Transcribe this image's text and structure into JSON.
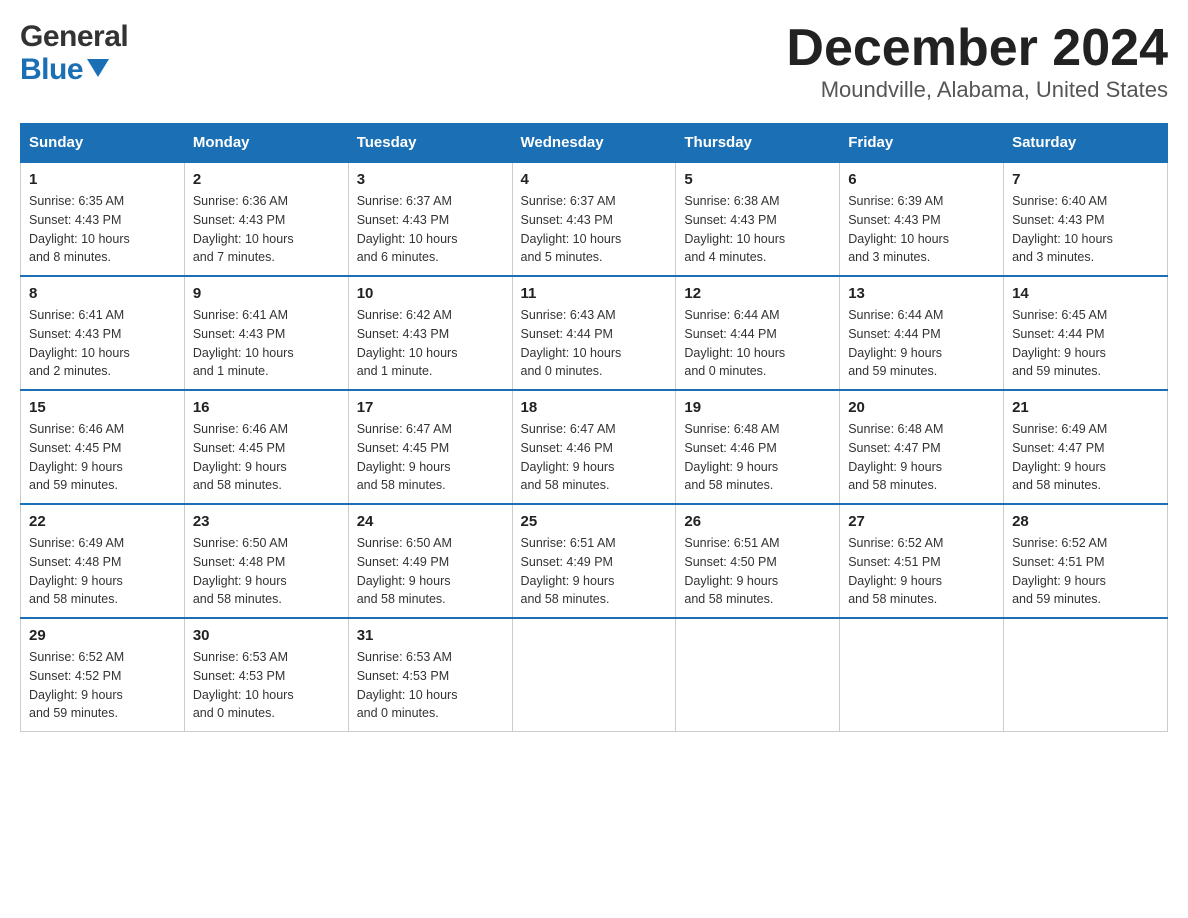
{
  "header": {
    "logo_general": "General",
    "logo_blue": "Blue",
    "month_title": "December 2024",
    "location": "Moundville, Alabama, United States"
  },
  "days_of_week": [
    "Sunday",
    "Monday",
    "Tuesday",
    "Wednesday",
    "Thursday",
    "Friday",
    "Saturday"
  ],
  "weeks": [
    [
      {
        "day": "1",
        "sunrise": "6:35 AM",
        "sunset": "4:43 PM",
        "daylight": "10 hours and 8 minutes."
      },
      {
        "day": "2",
        "sunrise": "6:36 AM",
        "sunset": "4:43 PM",
        "daylight": "10 hours and 7 minutes."
      },
      {
        "day": "3",
        "sunrise": "6:37 AM",
        "sunset": "4:43 PM",
        "daylight": "10 hours and 6 minutes."
      },
      {
        "day": "4",
        "sunrise": "6:37 AM",
        "sunset": "4:43 PM",
        "daylight": "10 hours and 5 minutes."
      },
      {
        "day": "5",
        "sunrise": "6:38 AM",
        "sunset": "4:43 PM",
        "daylight": "10 hours and 4 minutes."
      },
      {
        "day": "6",
        "sunrise": "6:39 AM",
        "sunset": "4:43 PM",
        "daylight": "10 hours and 3 minutes."
      },
      {
        "day": "7",
        "sunrise": "6:40 AM",
        "sunset": "4:43 PM",
        "daylight": "10 hours and 3 minutes."
      }
    ],
    [
      {
        "day": "8",
        "sunrise": "6:41 AM",
        "sunset": "4:43 PM",
        "daylight": "10 hours and 2 minutes."
      },
      {
        "day": "9",
        "sunrise": "6:41 AM",
        "sunset": "4:43 PM",
        "daylight": "10 hours and 1 minute."
      },
      {
        "day": "10",
        "sunrise": "6:42 AM",
        "sunset": "4:43 PM",
        "daylight": "10 hours and 1 minute."
      },
      {
        "day": "11",
        "sunrise": "6:43 AM",
        "sunset": "4:44 PM",
        "daylight": "10 hours and 0 minutes."
      },
      {
        "day": "12",
        "sunrise": "6:44 AM",
        "sunset": "4:44 PM",
        "daylight": "10 hours and 0 minutes."
      },
      {
        "day": "13",
        "sunrise": "6:44 AM",
        "sunset": "4:44 PM",
        "daylight": "9 hours and 59 minutes."
      },
      {
        "day": "14",
        "sunrise": "6:45 AM",
        "sunset": "4:44 PM",
        "daylight": "9 hours and 59 minutes."
      }
    ],
    [
      {
        "day": "15",
        "sunrise": "6:46 AM",
        "sunset": "4:45 PM",
        "daylight": "9 hours and 59 minutes."
      },
      {
        "day": "16",
        "sunrise": "6:46 AM",
        "sunset": "4:45 PM",
        "daylight": "9 hours and 58 minutes."
      },
      {
        "day": "17",
        "sunrise": "6:47 AM",
        "sunset": "4:45 PM",
        "daylight": "9 hours and 58 minutes."
      },
      {
        "day": "18",
        "sunrise": "6:47 AM",
        "sunset": "4:46 PM",
        "daylight": "9 hours and 58 minutes."
      },
      {
        "day": "19",
        "sunrise": "6:48 AM",
        "sunset": "4:46 PM",
        "daylight": "9 hours and 58 minutes."
      },
      {
        "day": "20",
        "sunrise": "6:48 AM",
        "sunset": "4:47 PM",
        "daylight": "9 hours and 58 minutes."
      },
      {
        "day": "21",
        "sunrise": "6:49 AM",
        "sunset": "4:47 PM",
        "daylight": "9 hours and 58 minutes."
      }
    ],
    [
      {
        "day": "22",
        "sunrise": "6:49 AM",
        "sunset": "4:48 PM",
        "daylight": "9 hours and 58 minutes."
      },
      {
        "day": "23",
        "sunrise": "6:50 AM",
        "sunset": "4:48 PM",
        "daylight": "9 hours and 58 minutes."
      },
      {
        "day": "24",
        "sunrise": "6:50 AM",
        "sunset": "4:49 PM",
        "daylight": "9 hours and 58 minutes."
      },
      {
        "day": "25",
        "sunrise": "6:51 AM",
        "sunset": "4:49 PM",
        "daylight": "9 hours and 58 minutes."
      },
      {
        "day": "26",
        "sunrise": "6:51 AM",
        "sunset": "4:50 PM",
        "daylight": "9 hours and 58 minutes."
      },
      {
        "day": "27",
        "sunrise": "6:52 AM",
        "sunset": "4:51 PM",
        "daylight": "9 hours and 58 minutes."
      },
      {
        "day": "28",
        "sunrise": "6:52 AM",
        "sunset": "4:51 PM",
        "daylight": "9 hours and 59 minutes."
      }
    ],
    [
      {
        "day": "29",
        "sunrise": "6:52 AM",
        "sunset": "4:52 PM",
        "daylight": "9 hours and 59 minutes."
      },
      {
        "day": "30",
        "sunrise": "6:53 AM",
        "sunset": "4:53 PM",
        "daylight": "10 hours and 0 minutes."
      },
      {
        "day": "31",
        "sunrise": "6:53 AM",
        "sunset": "4:53 PM",
        "daylight": "10 hours and 0 minutes."
      },
      null,
      null,
      null,
      null
    ]
  ],
  "labels": {
    "sunrise": "Sunrise:",
    "sunset": "Sunset:",
    "daylight": "Daylight:"
  }
}
